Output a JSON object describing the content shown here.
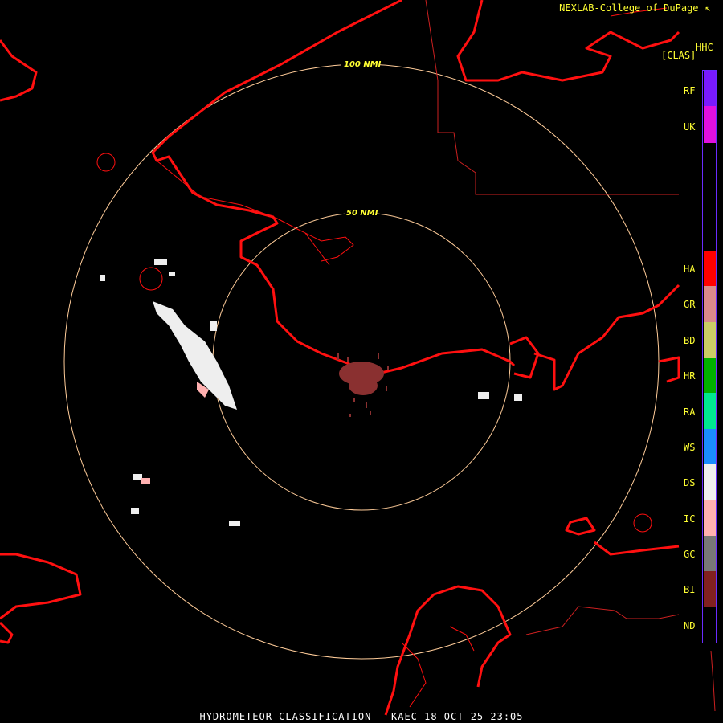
{
  "credit": "NEXLAB-College of DuPage",
  "credit_icon": "external-link-icon",
  "product_code": "HHC",
  "product_bracket": "[CLAS]",
  "footer_title": "HYDROMETEOR CLASSIFICATION - KAEC 18 OCT 25 23:05",
  "range_rings": [
    {
      "label": "100 NMI"
    },
    {
      "label": "50 NMI"
    }
  ],
  "legend": [
    {
      "code": "RF",
      "color": "#7a1aff"
    },
    {
      "code": "UK",
      "color": "#e010e0"
    },
    {
      "code": "HA",
      "color": "#ff0000"
    },
    {
      "code": "GR",
      "color": "#d98a8a"
    },
    {
      "code": "BD",
      "color": "#cccc66"
    },
    {
      "code": "HR",
      "color": "#00b000"
    },
    {
      "code": "RA",
      "color": "#00e890"
    },
    {
      "code": "WS",
      "color": "#1a8cff"
    },
    {
      "code": "DS",
      "color": "#eeeeee"
    },
    {
      "code": "IC",
      "color": "#ffb0b0"
    },
    {
      "code": "GC",
      "color": "#777777"
    },
    {
      "code": "BI",
      "color": "#802020"
    },
    {
      "code": "ND",
      "color": "#000000"
    }
  ],
  "colors": {
    "coastline": "#ff1010",
    "borders": "#cc2020",
    "rings": "#ffcc99",
    "text": "#ffff33"
  }
}
